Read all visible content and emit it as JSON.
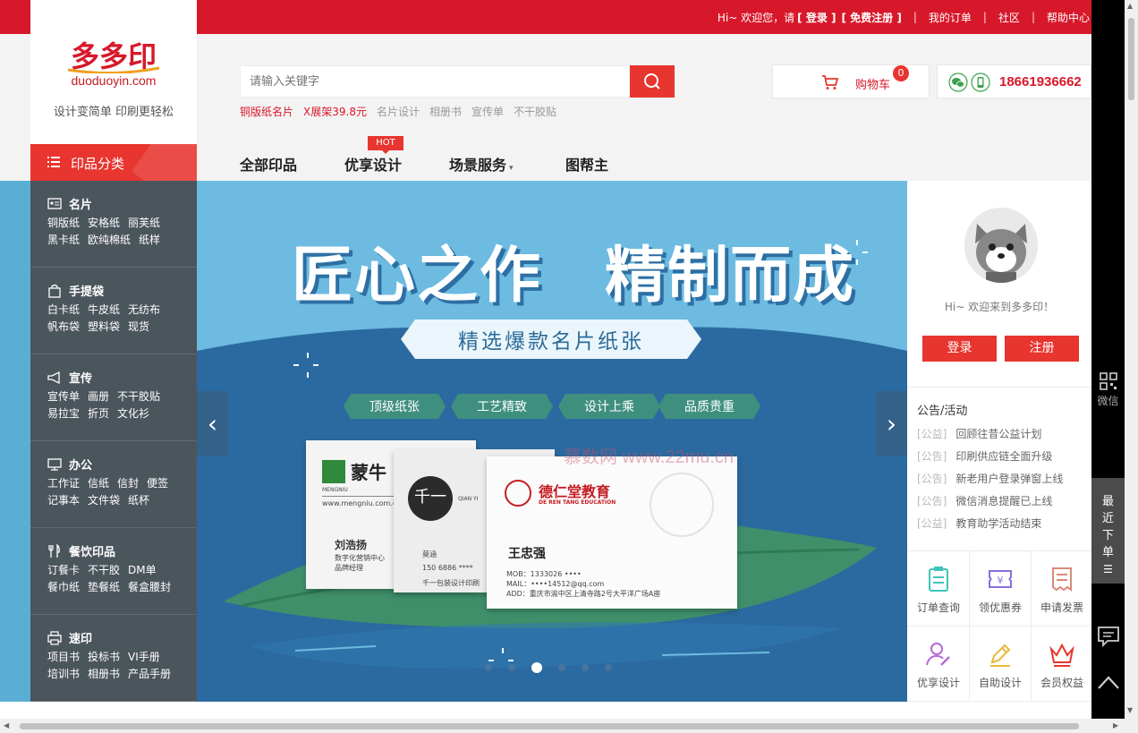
{
  "topbar": {
    "greeting_prefix": "Hi~ 欢迎您，请",
    "login": "[ 登录 ]",
    "register": "[ 免费注册 ]",
    "my_orders": "我的订单",
    "community": "社区",
    "help": "帮助中心"
  },
  "logo": {
    "brand": "多多印",
    "domain": "duoduoyin.com",
    "slogan": "设计变简单 印刷更轻松"
  },
  "search": {
    "placeholder": "请输入关键字",
    "hot_words": [
      {
        "text": "铜版纸名片",
        "style": "hot"
      },
      {
        "text": "X展架39.8元",
        "style": "hot"
      },
      {
        "text": "名片设计",
        "style": "norm"
      },
      {
        "text": "相册书",
        "style": "norm"
      },
      {
        "text": "宣传单",
        "style": "norm"
      },
      {
        "text": "不干胶贴",
        "style": "norm"
      }
    ]
  },
  "cart": {
    "label": "购物车",
    "count": "0"
  },
  "contact": {
    "phone": "18661936662"
  },
  "category_header": {
    "label": "印品分类"
  },
  "nav": {
    "items": [
      "全部印品",
      "优享设计",
      "场景服务",
      "图帮主"
    ],
    "hot_badge": "HOT"
  },
  "sidebar": {
    "categories": [
      {
        "title": "名片",
        "icon": "card-icon",
        "rows": [
          [
            "铜版纸",
            "安格纸",
            "丽芙纸"
          ],
          [
            "黑卡纸",
            "欧纯棉纸",
            "纸样"
          ]
        ]
      },
      {
        "title": "手提袋",
        "icon": "bag-icon",
        "rows": [
          [
            "白卡纸",
            "牛皮纸",
            "无纺布"
          ],
          [
            "帆布袋",
            "塑料袋",
            "现货"
          ]
        ]
      },
      {
        "title": "宣传",
        "icon": "megaphone-icon",
        "rows": [
          [
            "宣传单",
            "画册",
            "不干胶贴"
          ],
          [
            "易拉宝",
            "折页",
            "文化衫"
          ]
        ]
      },
      {
        "title": "办公",
        "icon": "monitor-icon",
        "rows": [
          [
            "工作证",
            "信纸",
            "信封",
            "便签"
          ],
          [
            "记事本",
            "文件袋",
            "纸杯"
          ]
        ]
      },
      {
        "title": "餐饮印品",
        "icon": "cutlery-icon",
        "rows": [
          [
            "订餐卡",
            "不干胶",
            "DM单"
          ],
          [
            "餐巾纸",
            "垫餐纸",
            "餐盒腰封"
          ]
        ]
      },
      {
        "title": "速印",
        "icon": "printer-icon",
        "rows": [
          [
            "项目书",
            "投标书",
            "VI手册"
          ],
          [
            "培训书",
            "相册书",
            "产品手册"
          ]
        ]
      }
    ]
  },
  "banner": {
    "headline": "匠心之作　精制而成",
    "ribbon": "精选爆款名片纸张",
    "tags": [
      "顶级纸张",
      "工艺精致",
      "设计上乘",
      "品质贵重"
    ],
    "card1": {
      "brand": "蒙牛",
      "sub": "MENGNIU",
      "web": "www.mengniu.com.cn",
      "name": "刘浩扬",
      "title1": "数字化营销中心",
      "title2": "品牌经理"
    },
    "card2": {
      "brand": "千一",
      "sub": "QIAN YI",
      "name": "莫涵",
      "phone": "150 6886 ****",
      "company": "千一包装设计印刷"
    },
    "card3": {
      "brand": "德仁堂教育",
      "sub": "DE REN TANG EDUCATION",
      "name": "王忠强",
      "mob": "MOB：1333026 ••••",
      "mail": "MAIL：••••14512@qq.com",
      "add": "ADD：重庆市渝中区上清寺路2号大平洋广场A座"
    },
    "watermark": "慕数网 www.22mu.cn",
    "prev": "‹",
    "next": "›",
    "active_slide": 3,
    "slide_count": 6
  },
  "user_panel": {
    "welcome": "Hi~ 欢迎来到多多印！",
    "login_button": "登录",
    "register_button": "注册"
  },
  "notices": {
    "title": "公告/活动",
    "items": [
      {
        "tag": "[公益]",
        "text": "回顾往昔公益计划"
      },
      {
        "tag": "[公告]",
        "text": "印刷供应链全面升级"
      },
      {
        "tag": "[公告]",
        "text": "新老用户登录弹窗上线"
      },
      {
        "tag": "[公告]",
        "text": "微信消息提醒已上线"
      },
      {
        "tag": "[公益]",
        "text": "教育助学活动结束"
      }
    ]
  },
  "services": [
    {
      "label": "订单查询",
      "icon": "clipboard-icon",
      "color": "#3ec6b9"
    },
    {
      "label": "领优惠券",
      "icon": "coupon-icon",
      "color": "#8b6ee0"
    },
    {
      "label": "申请发票",
      "icon": "invoice-icon",
      "color": "#d98a7a"
    },
    {
      "label": "优享设计",
      "icon": "designer-icon",
      "color": "#b46bd6"
    },
    {
      "label": "自助设计",
      "icon": "pencil-icon",
      "color": "#e8b93a"
    },
    {
      "label": "会员权益",
      "icon": "crown-icon",
      "color": "#e8352f"
    }
  ],
  "toolbar": {
    "wechat": "微信",
    "recent_orders": [
      "最",
      "近",
      "下",
      "单"
    ]
  },
  "colors": {
    "brand_red": "#d7182a",
    "accent_red": "#e8352f",
    "sidebar": "#4b555c",
    "banner_blue": "#6dbbe0"
  }
}
